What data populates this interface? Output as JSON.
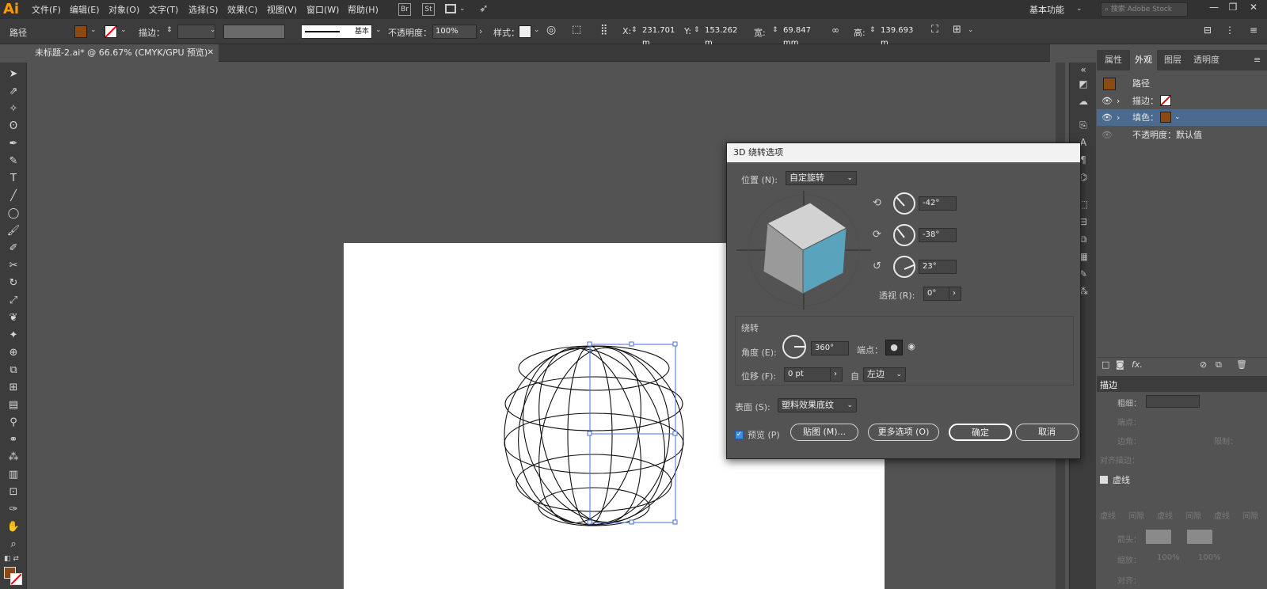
{
  "app": {
    "logo": "Ai"
  },
  "menubar": {
    "items": [
      "文件(F)",
      "编辑(E)",
      "对象(O)",
      "文字(T)",
      "选择(S)",
      "效果(C)",
      "视图(V)",
      "窗口(W)",
      "帮助(H)"
    ],
    "icons": {
      "br": "Br",
      "st": "St"
    },
    "workspace": "基本功能",
    "search_placeholder": "搜索 Adobe Stock"
  },
  "controlbar": {
    "object_type": "路径",
    "stroke_label": "描边：",
    "stroke_profile": "基本",
    "opacity_label": "不透明度：",
    "opacity_value": "100%",
    "style_label": "样式：",
    "x_label": "X:",
    "x_value": "231.701 m",
    "y_label": "Y:",
    "y_value": "153.262 m",
    "w_label": "宽:",
    "w_value": "69.847 mm",
    "h_label": "高:",
    "h_value": "139.693 m",
    "fill_color": "#8b4a14"
  },
  "document": {
    "tab_title": "未标题-2.ai* @ 66.67% (CMYK/GPU 预览)"
  },
  "right_panel": {
    "tabs": [
      "属性",
      "外观",
      "图层",
      "透明度"
    ],
    "active_tab": "外观",
    "appearance": {
      "object": "路径",
      "stroke_label": "描边：",
      "fill_label": "填色：",
      "opacity_label": "不透明度：",
      "opacity_value": "默认值"
    },
    "stroke_panel": {
      "title": "描边",
      "weight_label": "粗细：",
      "cap_label": "端点：",
      "corner_label": "边角：",
      "limit_label": "限制：",
      "align_label": "对齐描边：",
      "dashed_label": "虚线",
      "dash_cols": [
        "虚线",
        "间隙",
        "虚线",
        "间隙",
        "虚线",
        "间隙"
      ],
      "arrow_label": "箭头：",
      "scale_label": "缩放：",
      "scale_values": [
        "100%",
        "100%"
      ],
      "align2_label": "对齐："
    }
  },
  "dialog": {
    "title": "3D 绕转选项",
    "position_label": "位置 (N):",
    "position_value": "自定旋转",
    "rot_x": "-42°",
    "rot_y": "-38°",
    "rot_z": "23°",
    "perspective_label": "透视 (R):",
    "perspective_value": "0°",
    "revolve_group": "绕转",
    "angle_label": "角度 (E):",
    "angle_value": "360°",
    "cap_label": "端点：",
    "offset_label": "位移 (F):",
    "offset_value": "0 pt",
    "from_label": "自",
    "from_value": "左边",
    "surface_label": "表面 (S):",
    "surface_value": "塑料效果底纹",
    "preview_label": "预览 (P)",
    "map_button": "贴图 (M)...",
    "more_button": "更多选项 (O)",
    "ok_button": "确定",
    "cancel_button": "取消",
    "cube_colors": {
      "top": "#d2d2d2",
      "left": "#9a9a9a",
      "right": "#5aa3bd"
    }
  }
}
